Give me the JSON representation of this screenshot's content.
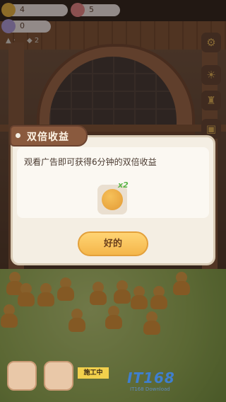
{
  "hud": {
    "gold_count": "4",
    "gem_count": "5",
    "candy_count": "0",
    "bag_count": "2"
  },
  "dialog": {
    "title": "双倍收益",
    "message": "观看广告即可获得6分钟的双倍收益",
    "reward_multiplier": "x2",
    "confirm_label": "好的"
  },
  "bottom_bar": {
    "construction_label": "施工中"
  },
  "watermark": {
    "text": "IT168",
    "subtext": "IT168 Download"
  },
  "colors": {
    "dialog_bg": "#f4eee3",
    "title_tag": "#8a5a3e",
    "button_yellow": "#f4b64a",
    "reward_green": "#5db54a"
  },
  "icons": [
    "sun-coin-icon",
    "pig-face-icon",
    "candy-icon",
    "bag-icon",
    "gear-icon",
    "sun-scroll-icon",
    "trophy-icon",
    "backpack-icon",
    "cookie-reward-icon"
  ]
}
